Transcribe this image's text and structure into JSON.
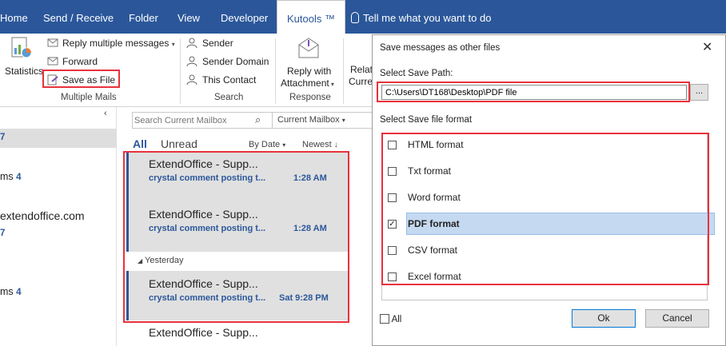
{
  "tabs": [
    "Home",
    "Send / Receive",
    "Folder",
    "View",
    "Developer",
    "Kutools ™",
    "Tell me what you want to do"
  ],
  "ribbon": {
    "statistics": "Statistics",
    "reply_multiple": "Reply multiple messages",
    "forward": "Forward",
    "save_as_file": "Save as File",
    "group_multiple_mails": "Multiple Mails",
    "sender": "Sender",
    "sender_domain": "Sender Domain",
    "this_contact": "This Contact",
    "group_search": "Search",
    "reply_with_line1": "Reply with",
    "reply_with_line2": "Attachment",
    "group_response": "Response",
    "rela": "Relat",
    "curre": "Curre"
  },
  "nav": {
    "item1_count": "7",
    "item2_text": "ms",
    "item2_count": "4",
    "item3_text": "extendoffice.com",
    "item4_count": "7",
    "item5_text": "ms",
    "item5_count": "4"
  },
  "list": {
    "search_placeholder": "Search Current Mailbox",
    "scope": "Current Mailbox",
    "filter_all": "All",
    "filter_unread": "Unread",
    "sort_by": "By Date",
    "sort_order": "Newest",
    "group_yesterday": "Yesterday",
    "mails": [
      {
        "from": "ExtendOffice - Supp...",
        "subject": "crystal comment posting t...",
        "time": "1:28 AM"
      },
      {
        "from": "ExtendOffice - Supp...",
        "subject": "crystal comment posting t...",
        "time": "1:28 AM"
      },
      {
        "from": "ExtendOffice - Supp...",
        "subject": "crystal comment posting t...",
        "time": "Sat 9:28 PM"
      },
      {
        "from": "ExtendOffice - Supp..."
      }
    ]
  },
  "dialog": {
    "title": "Save messages as other files",
    "save_path_label": "Select Save Path:",
    "save_path_value": "C:\\Users\\DT168\\Desktop\\PDF file",
    "browse": "...",
    "format_label": "Select Save file format",
    "formats": [
      {
        "label": "HTML format",
        "checked": false
      },
      {
        "label": "Txt format",
        "checked": false
      },
      {
        "label": "Word format",
        "checked": false
      },
      {
        "label": "PDF format",
        "checked": true
      },
      {
        "label": "CSV format",
        "checked": false
      },
      {
        "label": "Excel format",
        "checked": false
      }
    ],
    "all_label": "All",
    "ok": "Ok",
    "cancel": "Cancel"
  },
  "colors": {
    "brand": "#2b579a",
    "highlight": "#e8323c",
    "selection": "#c5d9f1"
  }
}
